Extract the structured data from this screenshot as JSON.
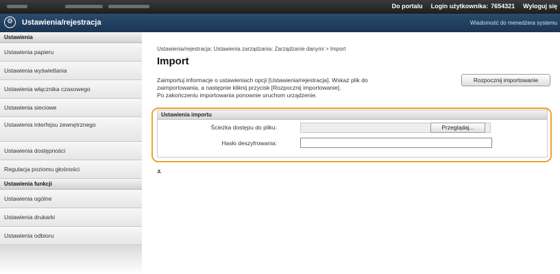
{
  "topbar": {
    "portal_link": "Do portalu",
    "login_label": "Login użytkownika:",
    "login_value": "7654321",
    "logout_link": "Wyloguj się"
  },
  "titlebar": {
    "logo_icon": "gear-settings-icon",
    "app_title": "Ustawienia/rejestracja",
    "admin_message_link": "Wiadomość do menedżera systemu"
  },
  "sidebar": {
    "section1": "Ustawienia",
    "items1": [
      "Ustawienia papieru",
      "Ustawienia wyświetlania",
      "Ustawienia włącznika czasowego",
      "Ustawienia sieciowe",
      "Ustawienia interfejsu zewnętrznego",
      "Ustawienia dostępności",
      "Regulacja poziomu głośności"
    ],
    "section2": "Ustawienia funkcji",
    "items2": [
      "Ustawienia ogólne",
      "Ustawienia drukarki",
      "Ustawienia odbioru"
    ]
  },
  "main": {
    "breadcrumb": "Ustawienia/rejestracja: Ustawienia zarządzania: Zarządzanie danymi > Import",
    "title": "Import",
    "description": [
      "Zaimportuj informacje o ustawieniach opcji [Ustawienia/rejestracja]. Wskaż plik do",
      "zaimportowania, a następnie kliknij przycisk [Rozpocznij importowanie].",
      "Po zakończeniu importowania ponownie uruchom urządzenie."
    ],
    "start_button": "Rozpocznij importowanie",
    "import_settings": {
      "header": "Ustawienia importu",
      "file_path_label": "Ścieżka dostępu do pliku:",
      "browse_button": "Przeglądaj...",
      "password_label": "Hasło deszyfrowania:",
      "password_value": ""
    },
    "to_top_icon": "scroll-to-top-icon",
    "to_top_glyph": "⩡"
  },
  "colors": {
    "highlight": "#f0a030",
    "titlebar": "#1f3a5a"
  }
}
